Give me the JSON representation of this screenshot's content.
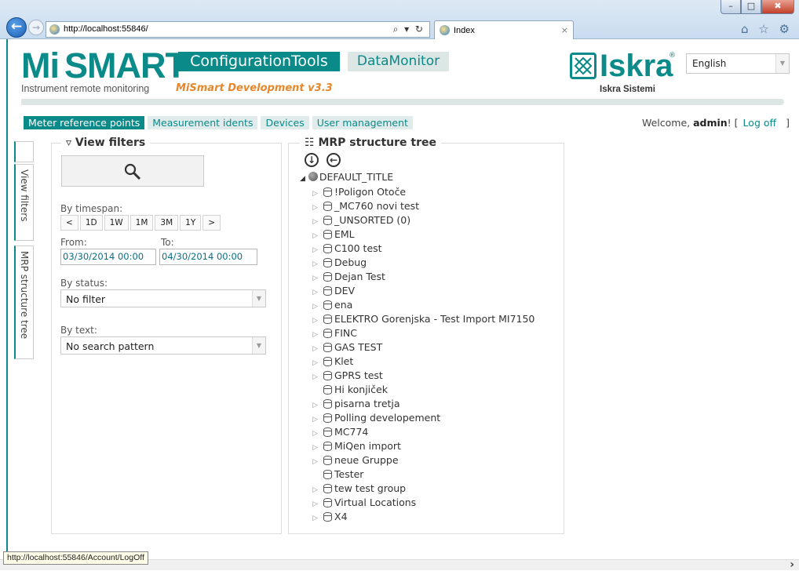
{
  "browser": {
    "url": "http://localhost:55846/",
    "tab_title": "Index",
    "address_tools": "⌕ ▾ ↻",
    "tab_close": "×",
    "toolbar_icons": "⌂ ☆ ⚙",
    "window_buttons": {
      "min": "–",
      "max": "□",
      "close": "✖"
    }
  },
  "header": {
    "logo_mi": "Mi",
    "logo_smart": "SMART",
    "logo_subtitle": "Instrument remote monitoring",
    "version": "MiSmart Development v3.3",
    "app_tabs": [
      "ConfigurationTools",
      "DataMonitor"
    ],
    "brand": "Iskra",
    "brand_reg": "®",
    "brand_sub": "Iskra Sistemi",
    "language": "English",
    "accent_color": "#0a8a89"
  },
  "nav": {
    "items": [
      "Meter reference points",
      "Measurement idents",
      "Devices",
      "User management"
    ],
    "active_index": 0
  },
  "user": {
    "welcome": "Welcome, ",
    "name": "admin",
    "bang_bracket": "! [",
    "logoff": "Log off",
    "close_bracket": "]"
  },
  "side_tabs": [
    "View filters",
    "MRP structure tree"
  ],
  "filters": {
    "title": "View filters",
    "timespan_label": "By timespan:",
    "timespan_buttons": [
      "<",
      "1D",
      "1W",
      "1M",
      "3M",
      "1Y",
      ">"
    ],
    "from_label": "From:",
    "to_label": "To:",
    "from_value": "03/30/2014 00:00",
    "to_value": "04/30/2014 00:00",
    "status_label": "By status:",
    "status_value": "No filter",
    "text_label": "By text:",
    "text_value": "No search pattern"
  },
  "tree": {
    "title": "MRP structure tree",
    "root": "DEFAULT_TITLE",
    "nodes": [
      {
        "label": "!Poligon Otoče",
        "expandable": true
      },
      {
        "label": "_MC760 novi test",
        "expandable": true
      },
      {
        "label": "_UNSORTED (0)",
        "expandable": true
      },
      {
        "label": "EML",
        "expandable": true
      },
      {
        "label": "C100 test",
        "expandable": true
      },
      {
        "label": "Debug",
        "expandable": true
      },
      {
        "label": "Dejan Test",
        "expandable": true
      },
      {
        "label": "DEV",
        "expandable": true
      },
      {
        "label": "ena",
        "expandable": true
      },
      {
        "label": "ELEKTRO Gorenjska - Test Import MI7150",
        "expandable": true
      },
      {
        "label": "FINC",
        "expandable": true
      },
      {
        "label": "GAS TEST",
        "expandable": true
      },
      {
        "label": "Klet",
        "expandable": true
      },
      {
        "label": "GPRS test",
        "expandable": true
      },
      {
        "label": "Hi konjiček",
        "expandable": false
      },
      {
        "label": "pisarna tretja",
        "expandable": true
      },
      {
        "label": "Polling developement",
        "expandable": true
      },
      {
        "label": "MC774",
        "expandable": true
      },
      {
        "label": "MiQen import",
        "expandable": true
      },
      {
        "label": "neue Gruppe",
        "expandable": true
      },
      {
        "label": "Tester",
        "expandable": false
      },
      {
        "label": "tew test group",
        "expandable": true
      },
      {
        "label": "Virtual Locations",
        "expandable": true
      },
      {
        "label": "X4",
        "expandable": true
      }
    ]
  },
  "status_bar": "http://localhost:55846/Account/LogOff"
}
